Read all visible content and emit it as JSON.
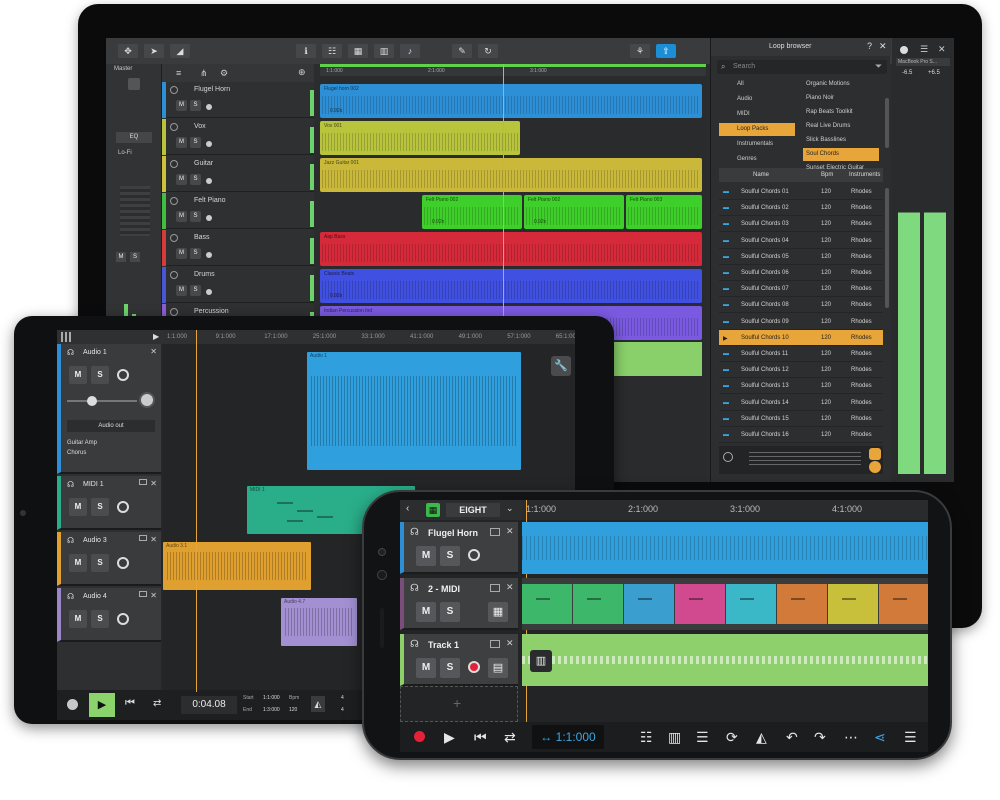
{
  "monitor": {
    "master_label": "Master",
    "eq_label": "EQ",
    "lofi_label": "Lo-Fi",
    "ruler_marks": [
      "1:1:000",
      "2:1:000",
      "3:1:000"
    ],
    "tracks": [
      {
        "name": "Flugel Horn",
        "color": "#2d8fd6"
      },
      {
        "name": "Vox",
        "color": "#b8c43c"
      },
      {
        "name": "Guitar",
        "color": "#d1c03a"
      },
      {
        "name": "Felt Piano",
        "color": "#3fbf3f"
      },
      {
        "name": "Bass",
        "color": "#d63a3a"
      },
      {
        "name": "Drums",
        "color": "#4a56d6"
      },
      {
        "name": "Percussion",
        "color": "#8b5dd6"
      }
    ],
    "track_buttons": {
      "mute": "M",
      "solo": "S"
    },
    "clips": {
      "flugel": "Flugel horn 002",
      "vox": "Vox 001",
      "guitar": "Jazz Guitar 001",
      "felt1": "Felt Piano 002",
      "felt2": "Felt Piano 002",
      "felt3": "Felt Piano 003",
      "bass": "Aap Bass",
      "drums": "Classic Beats",
      "perc": "Indian Percussion Ind",
      "felt1_stretch": "0.92x",
      "felt2_stretch": "0.92x",
      "flugel_stretch": "0.92x",
      "drums_stretch": "0.92x"
    },
    "browser": {
      "title": "Loop browser",
      "search_placeholder": "Search",
      "categories": [
        {
          "label": "All",
          "selected": false
        },
        {
          "label": "Audio",
          "selected": false
        },
        {
          "label": "MIDI",
          "selected": false
        },
        {
          "label": "Loop Packs",
          "selected": true
        },
        {
          "label": "Instrumentals",
          "selected": false
        },
        {
          "label": "Genres",
          "selected": false
        }
      ],
      "packs": [
        {
          "label": "Organic Motions",
          "selected": false
        },
        {
          "label": "Piano Noir",
          "selected": false
        },
        {
          "label": "Rap Beats Toolkit",
          "selected": false
        },
        {
          "label": "Real Live Drums",
          "selected": false
        },
        {
          "label": "Slick Basslines",
          "selected": false
        },
        {
          "label": "Soul Chords",
          "selected": true
        },
        {
          "label": "Sunset Electric Guitar",
          "selected": false
        }
      ],
      "columns": [
        "Name",
        "Bpm",
        "Instruments"
      ],
      "rows": [
        {
          "type": "midi",
          "name": "Soulful Chords 01",
          "bpm": "120",
          "inst": "Rhodes",
          "selected": false
        },
        {
          "type": "midi",
          "name": "Soulful Chords 02",
          "bpm": "120",
          "inst": "Rhodes",
          "selected": false
        },
        {
          "type": "midi",
          "name": "Soulful Chords 03",
          "bpm": "120",
          "inst": "Rhodes",
          "selected": false
        },
        {
          "type": "midi",
          "name": "Soulful Chords 04",
          "bpm": "120",
          "inst": "Rhodes",
          "selected": false
        },
        {
          "type": "midi",
          "name": "Soulful Chords 05",
          "bpm": "120",
          "inst": "Rhodes",
          "selected": false
        },
        {
          "type": "midi",
          "name": "Soulful Chords 06",
          "bpm": "120",
          "inst": "Rhodes",
          "selected": false
        },
        {
          "type": "midi",
          "name": "Soulful Chords 07",
          "bpm": "120",
          "inst": "Rhodes",
          "selected": false
        },
        {
          "type": "midi",
          "name": "Soulful Chords 08",
          "bpm": "120",
          "inst": "Rhodes",
          "selected": false
        },
        {
          "type": "midi",
          "name": "Soulful Chords 09",
          "bpm": "120",
          "inst": "Rhodes",
          "selected": false
        },
        {
          "type": "play",
          "name": "Soulful Chords 10",
          "bpm": "120",
          "inst": "Rhodes",
          "selected": true
        },
        {
          "type": "midi",
          "name": "Soulful Chords 11",
          "bpm": "120",
          "inst": "Rhodes",
          "selected": false
        },
        {
          "type": "midi",
          "name": "Soulful Chords 12",
          "bpm": "120",
          "inst": "Rhodes",
          "selected": false
        },
        {
          "type": "midi",
          "name": "Soulful Chords 13",
          "bpm": "120",
          "inst": "Rhodes",
          "selected": false
        },
        {
          "type": "midi",
          "name": "Soulful Chords 14",
          "bpm": "120",
          "inst": "Rhodes",
          "selected": false
        },
        {
          "type": "midi",
          "name": "Soulful Chords 15",
          "bpm": "120",
          "inst": "Rhodes",
          "selected": false
        },
        {
          "type": "midi",
          "name": "Soulful Chords 16",
          "bpm": "120",
          "inst": "Rhodes",
          "selected": false
        }
      ]
    },
    "meters": {
      "label": "MacBook Pro S...",
      "left": "-6.5",
      "right": "+6.5"
    }
  },
  "tablet": {
    "ruler_marks": [
      "1:1:000",
      "9:1:000",
      "17:1:000",
      "25:1:000",
      "33:1:000",
      "41:1:000",
      "49:1:000",
      "57:1:000",
      "65:1:000"
    ],
    "tracks": [
      {
        "name": "Audio 1",
        "color": "#2d8fd6"
      },
      {
        "name": "MIDI 1",
        "color": "#2aae8a"
      },
      {
        "name": "Audio 3",
        "color": "#e0a030"
      },
      {
        "name": "Audio 4",
        "color": "#9b86c8"
      }
    ],
    "buttons": {
      "mute": "M",
      "solo": "S"
    },
    "audio_out": "Audio out",
    "fx": [
      "Guitar Amp",
      "Chorus"
    ],
    "clips": {
      "audio1": "Audio 1",
      "midi1": "MIDI 1",
      "audio3": "Audio 3.1",
      "audio4": "Audio 4.7"
    },
    "time": "0:04.08",
    "start_label": "Start",
    "start_val": "1:1:000",
    "end_label": "End",
    "end_val": "1:3:000",
    "bpm_label": "Bpm",
    "bpm_val": "120",
    "sig_top": "4",
    "sig_bottom": "4"
  },
  "phone": {
    "project": "EIGHT",
    "ruler_marks": [
      "1:1:000",
      "2:1:000",
      "3:1:000",
      "4:1:000"
    ],
    "tracks": [
      {
        "name": "Flugel Horn",
        "color": "#2d8fd6"
      },
      {
        "name": "2 - MIDI",
        "color": "#7a4d7a"
      },
      {
        "name": "Track 1",
        "color": "#8dd06a"
      }
    ],
    "buttons": {
      "mute": "M",
      "solo": "S"
    },
    "position": "1:1:000",
    "add_track": "+"
  }
}
